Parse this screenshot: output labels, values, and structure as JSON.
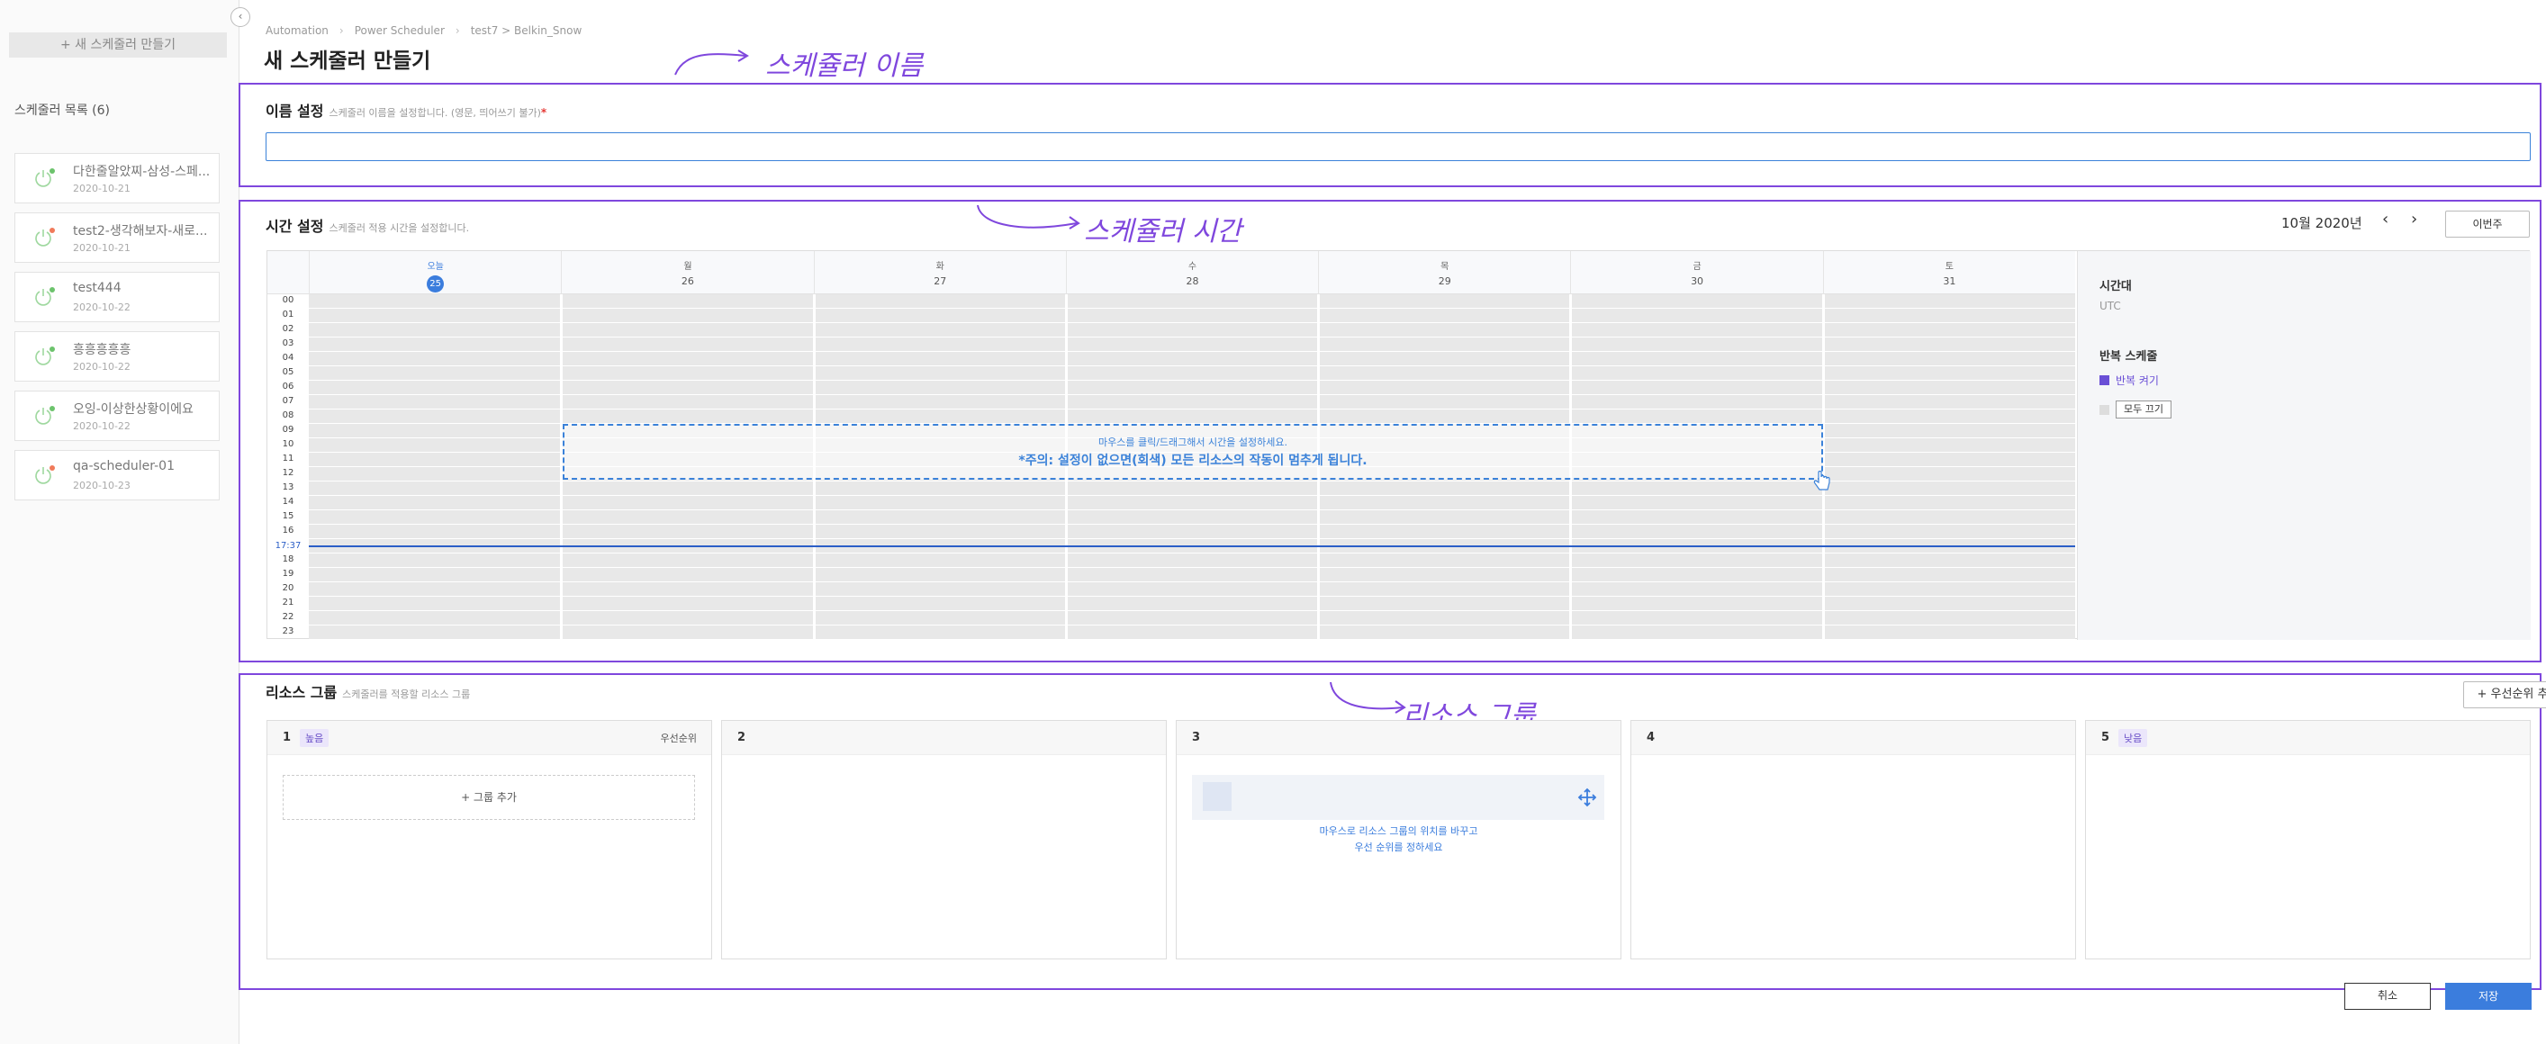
{
  "sidebar": {
    "new_scheduler_button": "+ 새 스케줄러 만들기",
    "list_title": "스케줄러 목록 (6)",
    "collapse_icon": "chevron-left-icon",
    "items": [
      {
        "name": "다한줄알았찌-삼성-스페...",
        "date": "2020-10-21",
        "status_color": "#6cc36c"
      },
      {
        "name": "test2-생각해보자-새로...",
        "date": "2020-10-21",
        "status_color": "#f07a5a"
      },
      {
        "name": "test444",
        "date": "2020-10-22",
        "status_color": "#6cc36c"
      },
      {
        "name": "흥흥흥흥흥",
        "date": "2020-10-22",
        "status_color": "#6cc36c"
      },
      {
        "name": "오잉-이상한상황이에요",
        "date": "2020-10-22",
        "status_color": "#6cc36c"
      },
      {
        "name": "qa-scheduler-01",
        "date": "2020-10-23",
        "status_color": "#f07a5a"
      }
    ]
  },
  "header": {
    "breadcrumb": [
      "Automation",
      "Power Scheduler",
      "test7 > Belkin_Snow"
    ],
    "title": "새 스케줄러 만들기"
  },
  "annotations": {
    "color": "#7f47dd",
    "name_label": "스케쥴러 이름",
    "time_label": "스케쥴러 시간",
    "group_label": "리소스 그룹"
  },
  "name_section": {
    "title": "이름 설정",
    "desc": "스케줄러 이름을 설정합니다. (영문, 띄어쓰기 불가)",
    "required": "*",
    "input_value": ""
  },
  "time_section": {
    "title": "시간 설정",
    "desc": "스케줄러 적용 시간을 설정합니다.",
    "month": "10월 2020년",
    "prev_icon": "chevron-left-icon",
    "next_icon": "chevron-right-icon",
    "this_week": "이번주",
    "days": [
      {
        "name": "오늘",
        "date": "25",
        "today": true
      },
      {
        "name": "월",
        "date": "26"
      },
      {
        "name": "화",
        "date": "27"
      },
      {
        "name": "수",
        "date": "28"
      },
      {
        "name": "목",
        "date": "29"
      },
      {
        "name": "금",
        "date": "30"
      },
      {
        "name": "토",
        "date": "31"
      }
    ],
    "hours": [
      "00",
      "01",
      "02",
      "03",
      "04",
      "05",
      "06",
      "07",
      "08",
      "09",
      "10",
      "11",
      "12",
      "13",
      "14",
      "15",
      "16",
      "",
      "18",
      "19",
      "20",
      "21",
      "22",
      "23"
    ],
    "now_label": "17:37",
    "hint_line1": "마우스를 클릭/드래그해서 시간을 설정하세요.",
    "hint_line2": "*주의: 설정이 없으면(회색) 모든 리소스의 작동이 멈추게 됩니다.",
    "timezone_title": "시간대",
    "timezone_value": "UTC",
    "repeat_title": "반복 스케줄",
    "repeat_on": "반복 켜기",
    "repeat_on_color": "#6a4fd6",
    "repeat_off": "모두 끄기"
  },
  "resource_section": {
    "title": "리소스 그룹",
    "desc": "스케줄러를 적용할 리소스 그룹",
    "add_priority": "+ 우선순위 추가",
    "columns": [
      {
        "num": "1",
        "badge": "높음",
        "right_label": "우선순위"
      },
      {
        "num": "2",
        "badge": "",
        "right_label": ""
      },
      {
        "num": "3",
        "badge": "",
        "right_label": ""
      },
      {
        "num": "4",
        "badge": "",
        "right_label": ""
      },
      {
        "num": "5",
        "badge": "낮음",
        "right_label": ""
      }
    ],
    "add_group": "+ 그룹 추가",
    "drag_hint_line1": "마우스로 리소스 그룹의 위치를 바꾸고",
    "drag_hint_line2": "우선 순위를 정하세요",
    "move_icon": "move-icon"
  },
  "footer": {
    "cancel": "취소",
    "save": "저장"
  }
}
